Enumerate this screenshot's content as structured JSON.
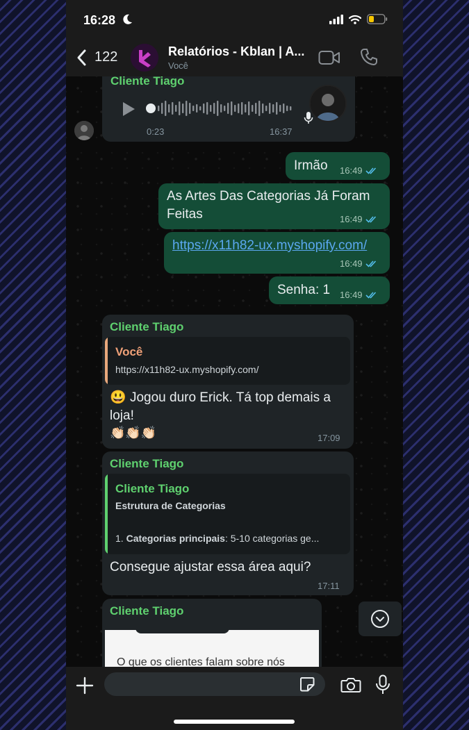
{
  "status_bar": {
    "time": "16:28"
  },
  "header": {
    "back_count": "122",
    "title": "Relatórios - Kblan | A...",
    "subtitle": "Você"
  },
  "messages": {
    "audio": {
      "sender": "Cliente Tiago",
      "duration": "0:23",
      "time": "16:37"
    },
    "out1": {
      "text": "Irmão",
      "time": "16:49"
    },
    "out2": {
      "text": "As Artes Das Categorias Já Foram Feitas",
      "time": "16:49"
    },
    "out3": {
      "text": "https://x11h82-ux.myshopify.com/",
      "time": "16:49"
    },
    "out4": {
      "text": "Senha: 1",
      "time": "16:49"
    },
    "reply1": {
      "sender": "Cliente Tiago",
      "quote_author": "Você",
      "quote_text": "https://x11h82-ux.myshopify.com/",
      "emoji": "😃",
      "text": "Jogou duro Erick. Tá top demais a loja!",
      "claps": "👏🏻👏🏻👏🏻",
      "time": "17:09"
    },
    "reply2": {
      "sender": "Cliente Tiago",
      "quote_author": "Cliente Tiago",
      "quote_title": "Estrutura de Categorias",
      "quote_item_prefix": "1.",
      "quote_item_bold": "Categorias principais",
      "quote_item_rest": ": 5-10 categorias ge...",
      "text": "Consegue ajustar essa área aqui?",
      "time": "17:11"
    },
    "image_msg": {
      "sender": "Cliente Tiago",
      "preview_text": "O que os clientes falam sobre nós"
    }
  },
  "input": {
    "placeholder": ""
  },
  "colors": {
    "outgoing_bubble": "#144d37",
    "incoming_bubble": "#1f2427",
    "sender_name": "#5fd16f",
    "link": "#5ba8f0",
    "read_ticks": "#53bdeb",
    "quote_you_bar": "#e8a87c",
    "quote_author_you": "#f0a178"
  },
  "icons": [
    "moon-icon",
    "signal-icon",
    "wifi-icon",
    "battery-icon",
    "back-chevron-icon",
    "video-call-icon",
    "phone-call-icon",
    "play-icon",
    "mic-icon",
    "double-check-icon",
    "chevron-down-circle-icon",
    "plus-icon",
    "sticker-icon",
    "camera-icon",
    "microphone-icon"
  ]
}
